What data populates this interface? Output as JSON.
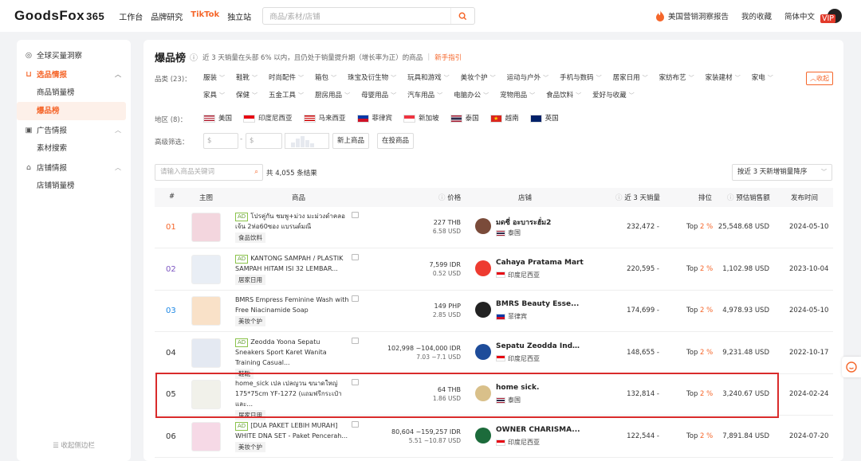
{
  "brand": {
    "name": "GoodsFox",
    "suffix": "365"
  },
  "nav": [
    "工作台",
    "品牌研究",
    "TikTok",
    "独立站"
  ],
  "search": {
    "placeholder": "商品/素材/店铺"
  },
  "top_right": {
    "report": "美国营销洞察报告",
    "favorites": "我的收藏",
    "language": "简体中文",
    "vip": "VIP"
  },
  "sidebar": {
    "items": [
      {
        "label": "全球买量洞察"
      },
      {
        "label": "选品情报"
      },
      {
        "label": "商品销量榜"
      },
      {
        "label": "爆品榜"
      },
      {
        "label": "广告情报"
      },
      {
        "label": "素材搜索"
      },
      {
        "label": "店铺情报"
      },
      {
        "label": "店铺销量榜"
      }
    ],
    "collapse": "收起侧边栏"
  },
  "header": {
    "title": "爆品榜",
    "desc": "近 3 天销量在头部 6% 以内，且仍处于销量提升期（增长率为正）的商品",
    "guide": "新手指引"
  },
  "filters": {
    "category_label": "品类 (23)：",
    "categories_row1": [
      "服装",
      "鞋靴",
      "时尚配件",
      "箱包",
      "珠宝及衍生物",
      "玩具和游戏",
      "美妆个护",
      "运动与户外",
      "手机与数码",
      "居家日用",
      "家纺布艺",
      "家装建材"
    ],
    "categories_row2": [
      "家电",
      "家具",
      "保健",
      "五金工具",
      "厨房用品",
      "母婴用品",
      "汽车用品",
      "电脑办公",
      "宠物用品",
      "食品饮料",
      "爱好与收藏"
    ],
    "fold": "收起",
    "region_label": "地区 (8)：",
    "regions": [
      "美国",
      "印度尼西亚",
      "马来西亚",
      "菲律宾",
      "新加坡",
      "泰国",
      "越南",
      "英国"
    ],
    "advanced_label": "高级筛选：",
    "price_min": "$",
    "price_max": "$",
    "new_items": "新上商品",
    "ads_items": "在投商品"
  },
  "list": {
    "search_placeholder": "请输入商品关键词",
    "count": "共 4,055 条结果",
    "sort": "按近 3 天新增销量降序"
  },
  "columns": [
    "#",
    "主图",
    "商品",
    "价格",
    "店铺",
    "近 3 天销量",
    "排位",
    "预估销售额",
    "发布时间"
  ],
  "rows": [
    {
      "rank": "01",
      "ad": "AD",
      "name": "โปรคู่กัน ชมพู+ม่วง มะม่วงดำคลอเจ้น 2ห่อ60ซอง แบรนด์มณี",
      "tag": "食品饮料",
      "price": "227 THB",
      "price_usd": "6.58 USD",
      "shop": "มดซี่ อะบาระฮั่ม2",
      "country": "泰国",
      "sales": "232,472 -",
      "pos": "Top 2 %",
      "gmv": "25,548.68 USD",
      "date": "2024-05-10",
      "rank_color": "#f5662a"
    },
    {
      "rank": "02",
      "ad": "AD",
      "name": "KANTONG SAMPAH / PLASTIK SAMPAH HITAM ISI 32 LEMBAR...",
      "tag": "居家日用",
      "price": "7,599 IDR",
      "price_usd": "0.52 USD",
      "shop": "Cahaya Pratama Mart",
      "country": "印度尼西亚",
      "sales": "220,595 -",
      "pos": "Top 2 %",
      "gmv": "1,102.98 USD",
      "date": "2023-10-04",
      "rank_color": "#7e57c2"
    },
    {
      "rank": "03",
      "ad": "",
      "name": "BMRS Empress Feminine Wash with Free Niacinamide Soap",
      "tag": "美妆个护",
      "price": "149 PHP",
      "price_usd": "2.85 USD",
      "shop": "BMRS Beauty Esse...",
      "country": "菲律宾",
      "sales": "174,699 -",
      "pos": "Top 2 %",
      "gmv": "4,978.93 USD",
      "date": "2024-05-10",
      "rank_color": "#1e88e5"
    },
    {
      "rank": "04",
      "ad": "AD",
      "name": "Zeodda Yoona Sepatu Sneakers Sport Karet Wanita Training Casual...",
      "tag": "鞋靴",
      "price": "102,998 ~104,000 IDR",
      "price_usd": "7.03 ~7.1 USD",
      "shop": "Sepatu Zeodda Indo...",
      "country": "印度尼西亚",
      "sales": "148,655 -",
      "pos": "Top 2 %",
      "gmv": "9,231.48 USD",
      "date": "2022-10-17",
      "rank_color": "#333"
    },
    {
      "rank": "05",
      "ad": "",
      "name": "home_sick เปล เปลญวน ขนาดใหญ่ 175*75cm YF-1272 (แถมฟรีกระเป๋าและ...",
      "tag": "居家日用",
      "price": "64 THB",
      "price_usd": "1.86 USD",
      "shop": "home sick.",
      "country": "泰国",
      "sales": "132,814 -",
      "pos": "Top 2 %",
      "gmv": "3,240.67 USD",
      "date": "2024-02-24",
      "rank_color": "#333"
    },
    {
      "rank": "06",
      "ad": "AD",
      "name": "[DUA PAKET LEBIH MURAH] WHITE DNA SET - Paket Pencerah...",
      "tag": "美妆个护",
      "price": "80,604 ~159,257 IDR",
      "price_usd": "5.51 ~10.87 USD",
      "shop": "OWNER CHARISMA...",
      "country": "印度尼西亚",
      "sales": "122,544 -",
      "pos": "Top 2 %",
      "gmv": "7,891.84 USD",
      "date": "2024-07-20",
      "rank_color": "#333"
    }
  ]
}
